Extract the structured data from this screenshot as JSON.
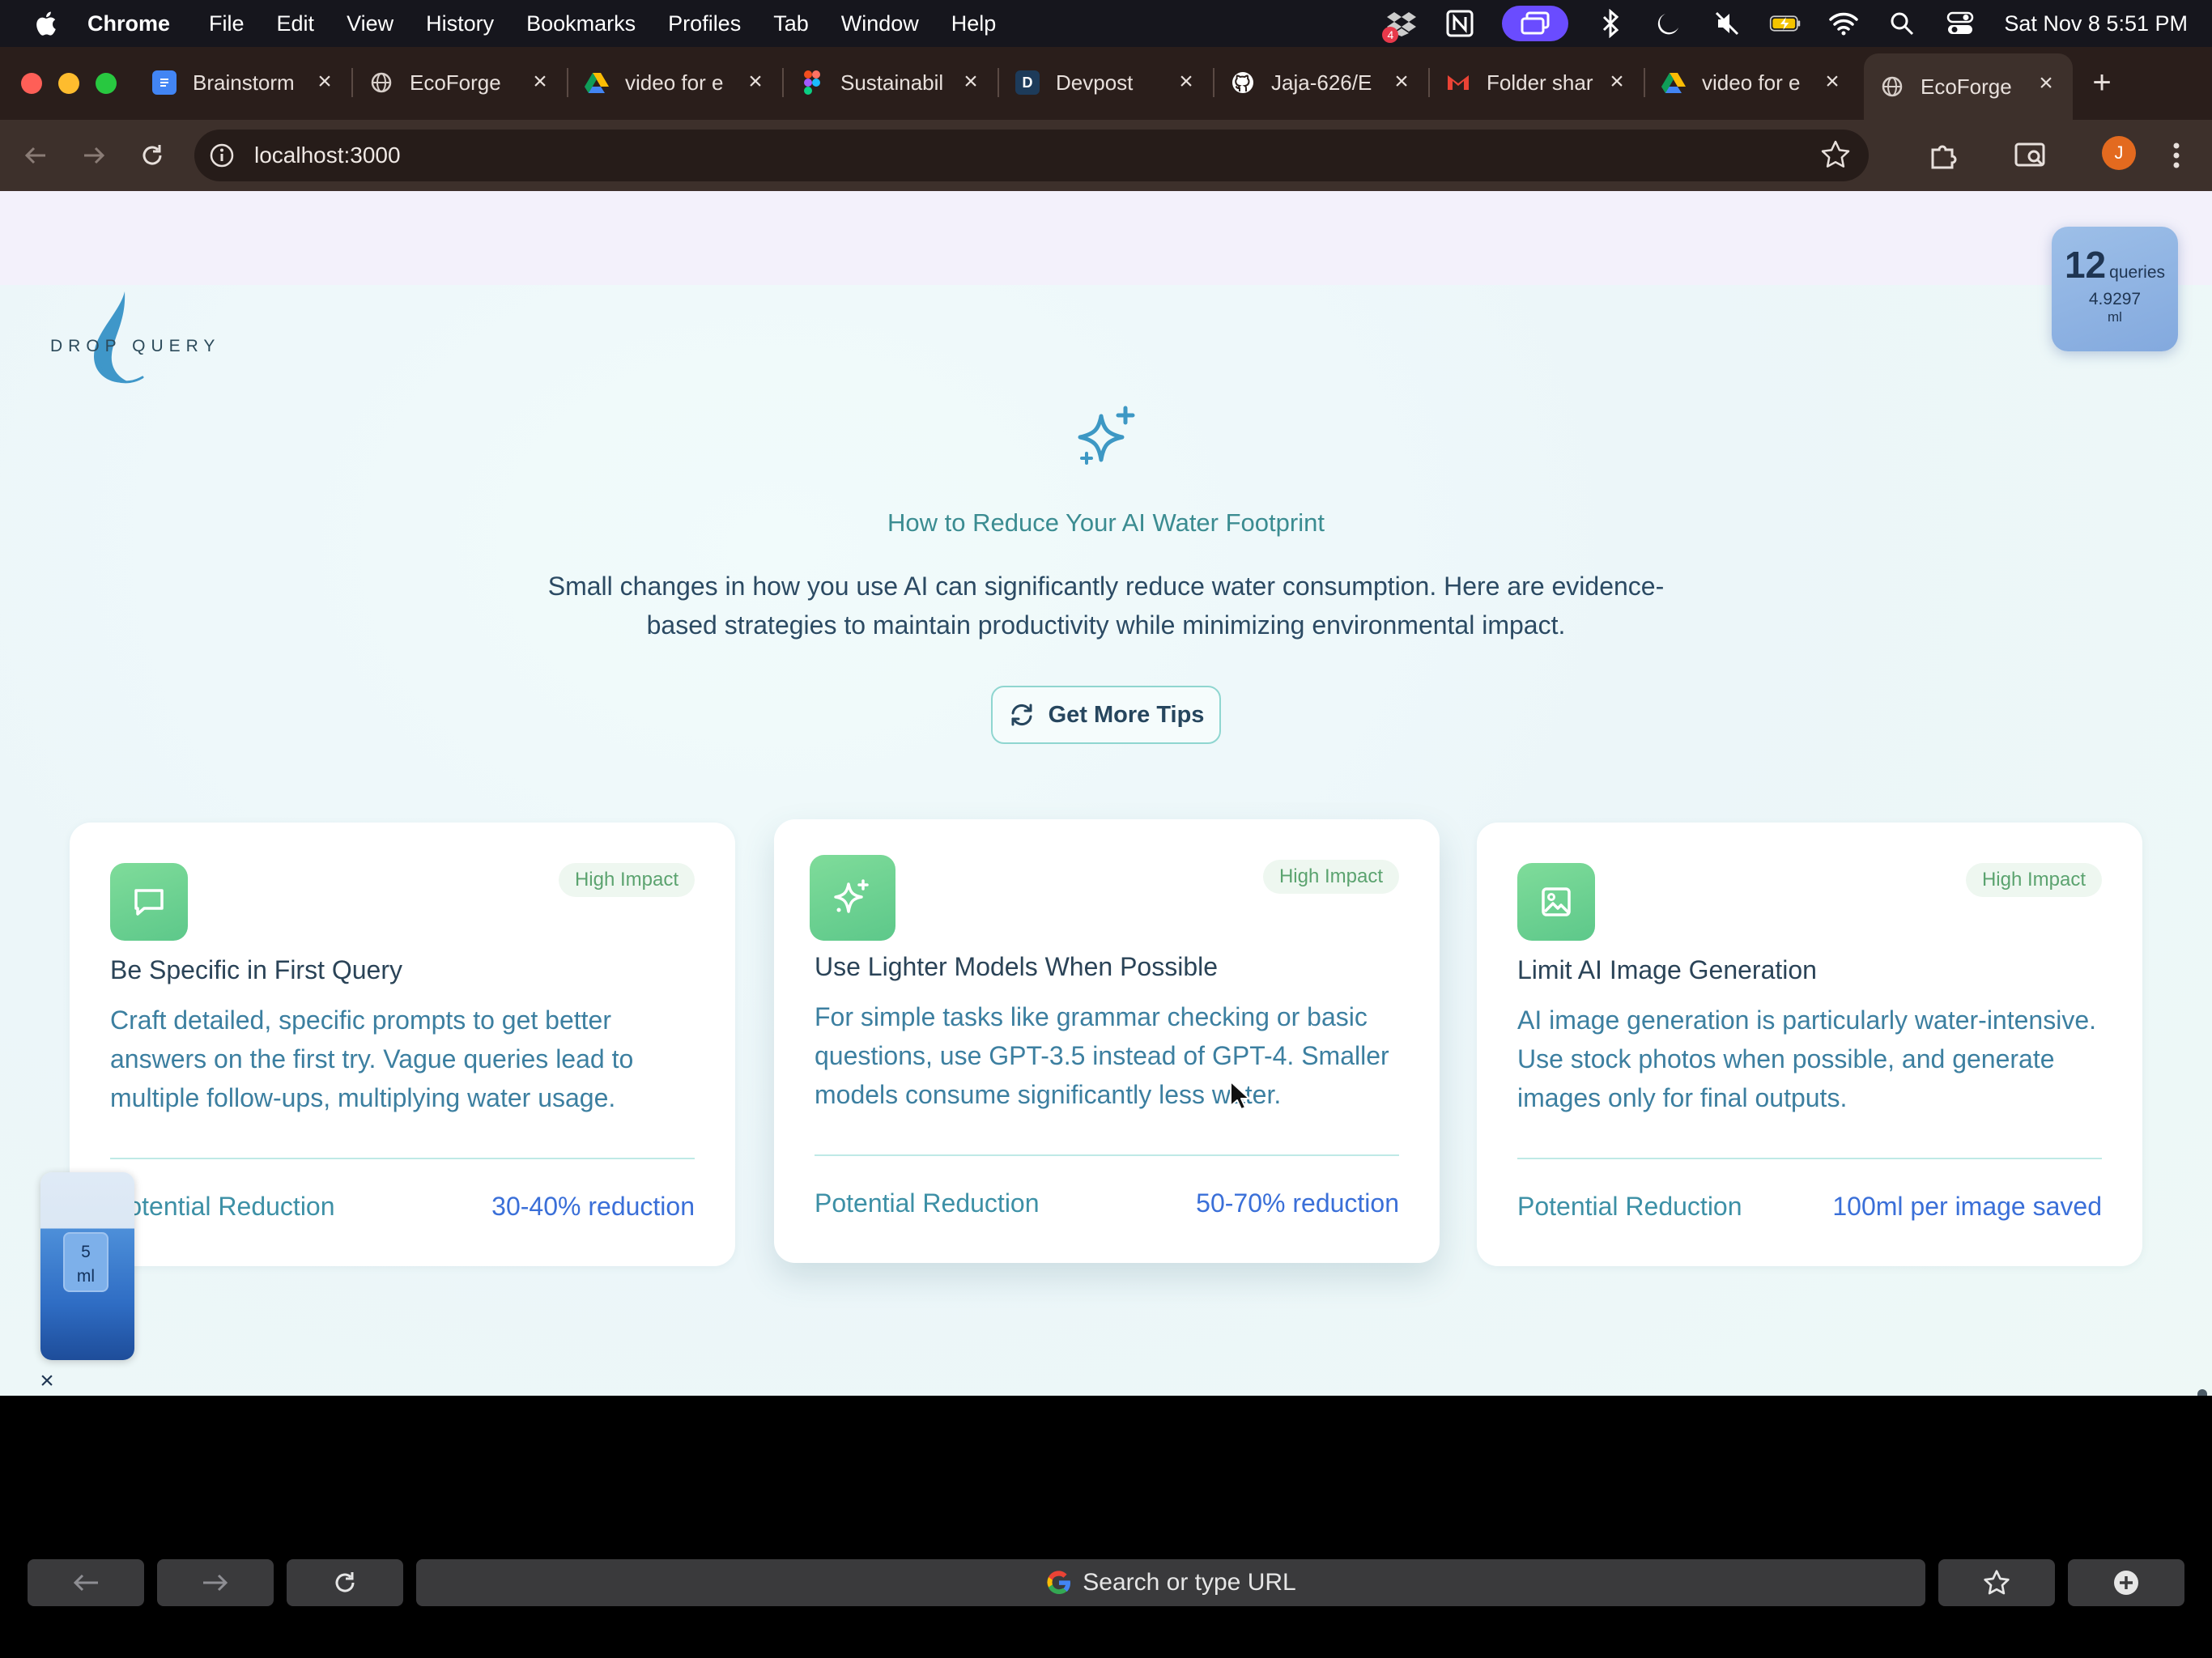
{
  "menubar": {
    "app_name": "Chrome",
    "items": [
      "File",
      "Edit",
      "View",
      "History",
      "Bookmarks",
      "Profiles",
      "Tab",
      "Window",
      "Help"
    ],
    "dropbox_badge": "4",
    "clock": "Sat Nov 8  5:51 PM"
  },
  "tabs": [
    {
      "title": "Brainstorm",
      "icon": "google-docs-icon"
    },
    {
      "title": "EcoForge",
      "icon": "globe-icon"
    },
    {
      "title": "video for e",
      "icon": "google-drive-icon"
    },
    {
      "title": "Sustainabil",
      "icon": "figma-icon"
    },
    {
      "title": "Devpost",
      "icon": "devpost-icon",
      "icon_text": "D"
    },
    {
      "title": "Jaja-626/E",
      "icon": "github-icon"
    },
    {
      "title": "Folder shar",
      "icon": "gmail-icon"
    },
    {
      "title": "video for e",
      "icon": "google-drive-icon"
    },
    {
      "title": "EcoForge",
      "icon": "globe-icon",
      "active": true
    }
  ],
  "toolbar": {
    "url": "localhost:3000",
    "profile_initial": "J"
  },
  "logo": {
    "text": "DROP QUERY"
  },
  "query_counter": {
    "count": "12",
    "count_label": "queries",
    "ml_value": "4.9297",
    "ml_unit": "ml"
  },
  "section": {
    "title": "How to Reduce Your AI Water Footprint",
    "description": "Small changes in how you use AI can significantly reduce water consumption. Here are evidence-based strategies to maintain productivity while minimizing environmental impact.",
    "tips_button": "Get More Tips"
  },
  "cards": [
    {
      "icon": "chat-bubble-icon",
      "badge": "High Impact",
      "title": "Be Specific in First Query",
      "description": "Craft detailed, specific prompts to get better answers on the first try. Vague queries lead to multiple follow-ups, multiplying water usage.",
      "reduction_label": "Potential Reduction",
      "reduction_value": "30-40% reduction"
    },
    {
      "icon": "sparkle-icon",
      "badge": "High Impact",
      "title": "Use Lighter Models When Possible",
      "description": "For simple tasks like grammar checking or basic questions, use GPT-3.5 instead of GPT-4. Smaller models consume significantly less water.",
      "reduction_label": "Potential Reduction",
      "reduction_value": "50-70% reduction"
    },
    {
      "icon": "image-icon",
      "badge": "High Impact",
      "title": "Limit AI Image Generation",
      "description": "AI image generation is particularly water-intensive. Use stock photos when possible, and generate images only for final outputs.",
      "reduction_label": "Potential Reduction",
      "reduction_value": "100ml per image saved"
    }
  ],
  "water_widget": {
    "ml_value": "5",
    "ml_unit": "ml",
    "close": "×"
  },
  "bottom_bar": {
    "search_placeholder": "Search or type URL"
  },
  "colors": {
    "accent_teal": "#3b8c91",
    "card_icon_green": "#6dd38f",
    "reduction_blue": "#3a6fd8",
    "footer_band": "#2d4a5f"
  }
}
